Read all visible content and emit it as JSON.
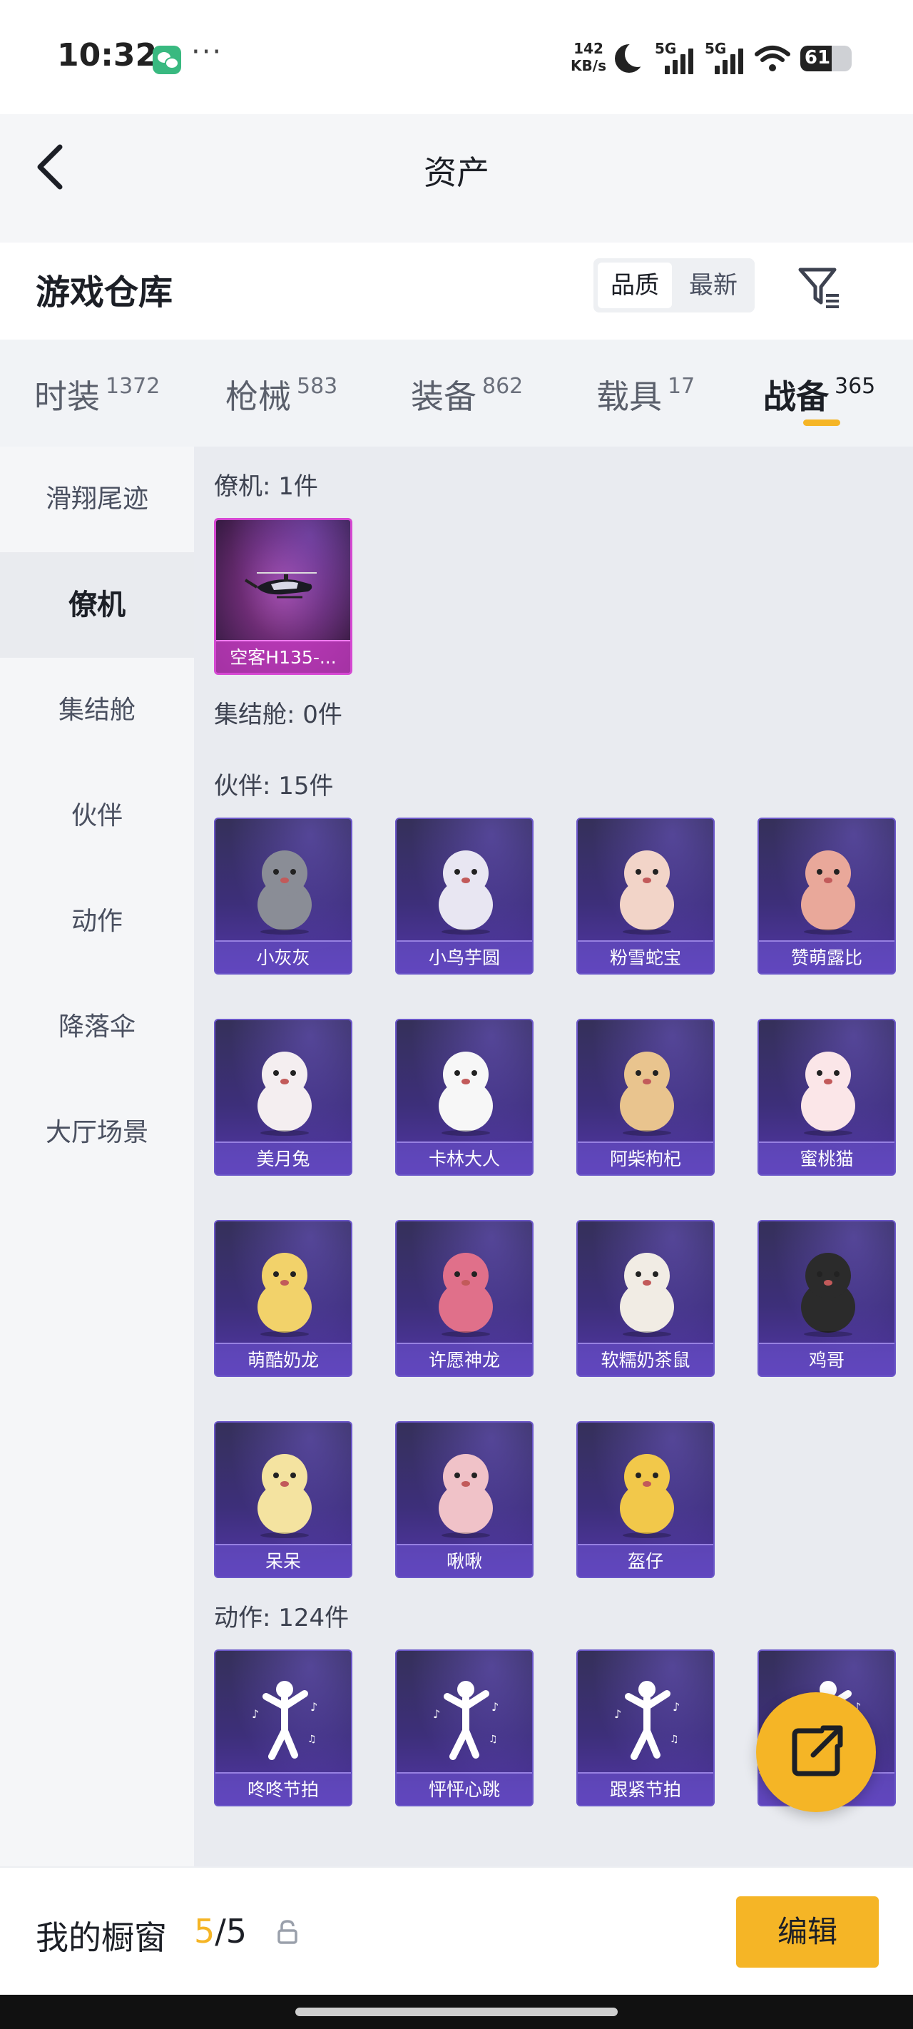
{
  "status_bar": {
    "time": "10:32",
    "net_speed_value": "142",
    "net_speed_unit": "KB/s",
    "signal_1_label": "5G",
    "signal_2_label": "5G",
    "battery": "61",
    "battery_level": 0.61,
    "icons": [
      "wechat-icon",
      "more-icon",
      "moon-icon",
      "signal-icon",
      "wifi-icon",
      "battery-icon"
    ]
  },
  "header": {
    "title": "资产"
  },
  "warehouse": {
    "title": "游戏仓库",
    "sort_options": [
      "品质",
      "最新"
    ],
    "active_sort": "品质"
  },
  "tabs": [
    {
      "label": "时装",
      "count": "1372"
    },
    {
      "label": "枪械",
      "count": "583"
    },
    {
      "label": "装备",
      "count": "862"
    },
    {
      "label": "载具",
      "count": "17"
    },
    {
      "label": "战备",
      "count": "365",
      "active": true
    }
  ],
  "sidebar": {
    "items": [
      {
        "label": "滑翔尾迹"
      },
      {
        "label": "僚机",
        "active": true
      },
      {
        "label": "集结舱"
      },
      {
        "label": "伙伴"
      },
      {
        "label": "动作"
      },
      {
        "label": "降落伞"
      },
      {
        "label": "大厅场景"
      }
    ]
  },
  "content": {
    "sections": [
      {
        "title": "僚机: 1件",
        "items": [
          "空客H135-..."
        ]
      },
      {
        "title": "集结舱: 0件",
        "items": []
      },
      {
        "title": "伙伴: 15件",
        "items": [
          "小灰灰",
          "小鸟芋圆",
          "粉雪蛇宝",
          "赞萌露比",
          "美月兔",
          "卡林大人",
          "阿柴枸杞",
          "蜜桃猫",
          "萌酷奶龙",
          "许愿神龙",
          "软糯奶茶鼠",
          "鸡哥",
          "呆呆",
          "啾啾",
          "盔仔"
        ]
      },
      {
        "title": "动作: 124件",
        "items": [
          "咚咚节拍",
          "怦怦心跳",
          "跟紧节拍",
          "…"
        ]
      }
    ]
  },
  "bottom": {
    "label": "我的橱窗",
    "count_current": "5",
    "count_sep": "/",
    "count_total": "5",
    "edit_label": "编辑"
  },
  "colors": {
    "accent": "#f5b526",
    "card_purple": "#3d2f7a",
    "card_pink": "#d548d2",
    "panel": "#e9ebf0"
  }
}
